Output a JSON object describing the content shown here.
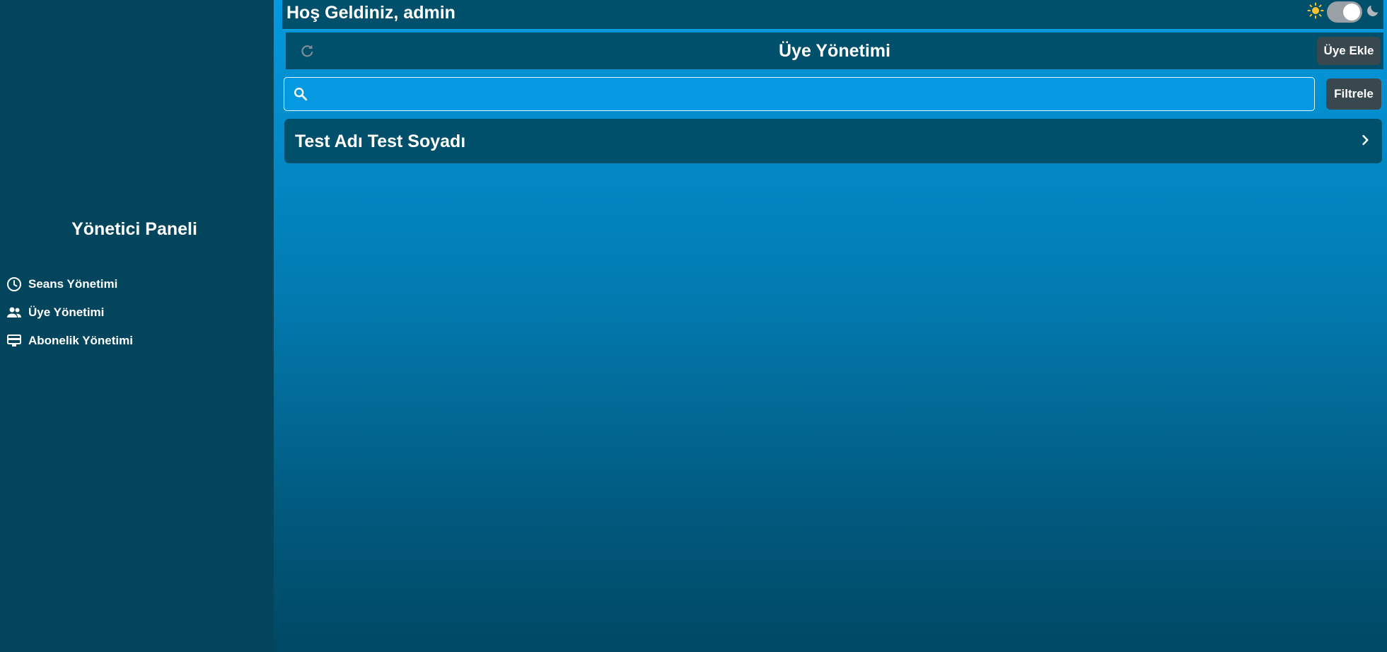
{
  "welcome": "Hoş Geldiniz, admin",
  "sidebar": {
    "title": "Yönetici Paneli",
    "items": [
      {
        "label": "Seans Yönetimi",
        "icon": "clock-icon"
      },
      {
        "label": "Üye Yönetimi",
        "icon": "people-icon"
      },
      {
        "label": "Abonelik Yönetimi",
        "icon": "card-icon"
      }
    ]
  },
  "header": {
    "title": "Üye Yönetimi",
    "add_label": "Üye Ekle"
  },
  "search": {
    "placeholder": "",
    "value": ""
  },
  "filter_label": "Filtrele",
  "members": [
    {
      "name": "Test Adı Test Soyadı"
    }
  ],
  "theme": {
    "light_icon": "sun-icon",
    "dark_icon": "moon-icon",
    "toggle_on": true
  },
  "colors": {
    "sidebar": "#02455c",
    "panel": "#01506b",
    "accent": "#0499e0",
    "button": "#39474f",
    "sun": "#f6c12c"
  }
}
